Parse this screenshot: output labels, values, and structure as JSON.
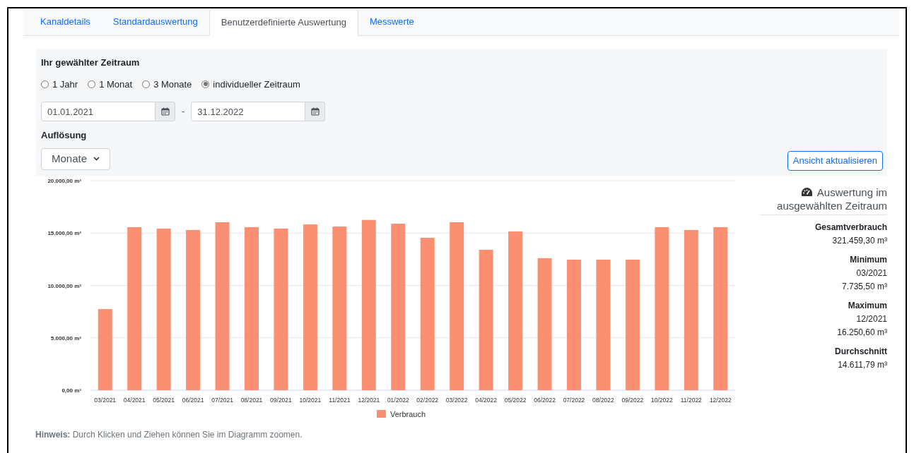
{
  "tabs": [
    {
      "label": "Kanaldetails",
      "selected": false
    },
    {
      "label": "Standardauswertung",
      "selected": false
    },
    {
      "label": "Benutzerdefinierte Auswertung",
      "selected": true
    },
    {
      "label": "Messwerte",
      "selected": false
    }
  ],
  "period": {
    "title": "Ihr gewählter Zeitraum",
    "options": [
      {
        "label": "1 Jahr",
        "selected": false
      },
      {
        "label": "1 Monat",
        "selected": false
      },
      {
        "label": "3 Monate",
        "selected": false
      },
      {
        "label": "individueller Zeitraum",
        "selected": true
      }
    ],
    "from": "01.01.2021",
    "separator": "-",
    "to": "31.12.2022"
  },
  "resolution": {
    "title": "Auflösung",
    "value": "Monate"
  },
  "update_button": "Ansicht aktualisieren",
  "chart": {
    "chart_data": {
      "type": "bar",
      "categories": [
        "03/2021",
        "04/2021",
        "05/2021",
        "06/2021",
        "07/2021",
        "08/2021",
        "09/2021",
        "10/2021",
        "11/2021",
        "12/2021",
        "01/2022",
        "02/2022",
        "03/2022",
        "04/2022",
        "05/2022",
        "06/2022",
        "07/2022",
        "08/2022",
        "09/2022",
        "10/2022",
        "11/2022",
        "12/2022"
      ],
      "series": [
        {
          "name": "Verbrauch",
          "color": "#fa8f72",
          "values": [
            7740,
            15560,
            15420,
            15290,
            16030,
            15560,
            15420,
            15820,
            15620,
            16250,
            15890,
            14550,
            16030,
            13400,
            15150,
            12600,
            12460,
            12460,
            12460,
            15560,
            15290,
            15560
          ]
        }
      ],
      "ylim": [
        0,
        20000
      ],
      "grid": true,
      "yticks": [
        {
          "value": 0,
          "label": "0,00 m³"
        },
        {
          "value": 5000,
          "label": "5.000,00 m³"
        },
        {
          "value": 10000,
          "label": "10.000,00 m³"
        },
        {
          "value": 15000,
          "label": "15.000,00 m³"
        },
        {
          "value": 20000,
          "label": "20.000,00 m³"
        }
      ]
    }
  },
  "summary": {
    "title": "Auswertung im ausgewählten Zeitraum",
    "items": [
      {
        "label": "Gesamtverbrauch",
        "values": [
          "321.459,30 m³"
        ]
      },
      {
        "label": "Minimum",
        "values": [
          "03/2021",
          "7.735,50 m³"
        ]
      },
      {
        "label": "Maximum",
        "values": [
          "12/2021",
          "16.250,60 m³"
        ]
      },
      {
        "label": "Durchschnitt",
        "values": [
          "14.611,79 m³"
        ]
      }
    ]
  },
  "hint": "**Hinweis:** Durch Klicken und Ziehen können Sie im Diagramm zoomen."
}
